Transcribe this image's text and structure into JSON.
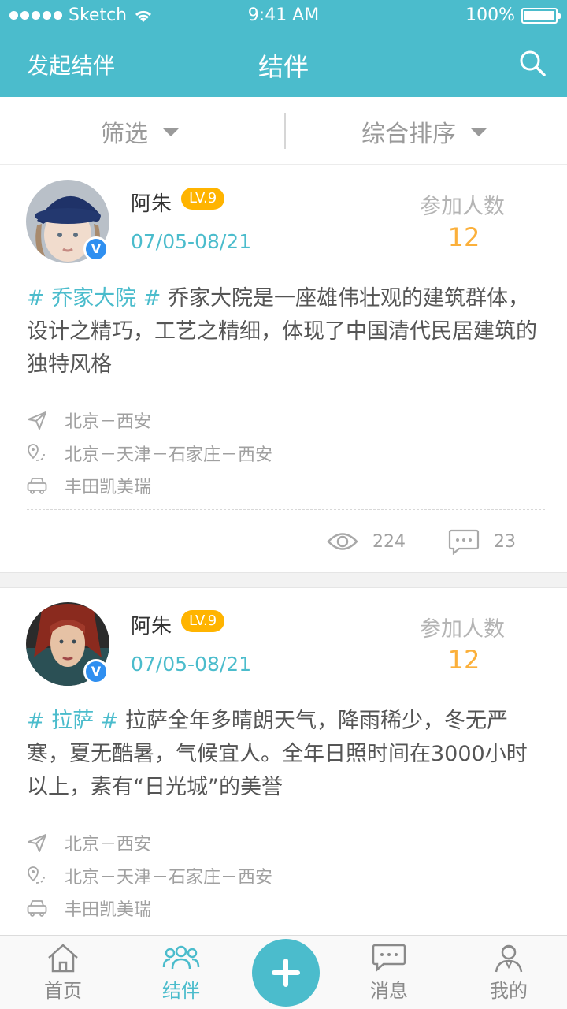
{
  "status_bar": {
    "carrier": "Sketch",
    "time": "9:41 AM",
    "battery": "100%"
  },
  "nav": {
    "left_action": "发起结伴",
    "title": "结伴",
    "search_icon": "search-icon"
  },
  "filters": [
    {
      "label": "筛选"
    },
    {
      "label": "综合排序"
    }
  ],
  "posts": [
    {
      "name": "阿朱",
      "level": "LV.9",
      "date_range": "07/05-08/21",
      "join_label": "参加人数",
      "join_count": "12",
      "tag": "# 乔家大院 #",
      "text": " 乔家大院是一座雄伟壮观的建筑群体，设计之精巧，工艺之精细，体现了中国清代民居建筑的独特风格",
      "route": "北京－西安",
      "waypoints": "北京－天津－石家庄－西安",
      "car": "丰田凯美瑞",
      "views": "224",
      "comments": "23"
    },
    {
      "name": "阿朱",
      "level": "LV.9",
      "date_range": "07/05-08/21",
      "join_label": "参加人数",
      "join_count": "12",
      "tag": "# 拉萨 #",
      "text": " 拉萨全年多晴朗天气，降雨稀少，冬无严寒，夏无酷暑，气候宜人。全年日照时间在3000小时以上，素有“日光城”的美誉",
      "route": "北京－西安",
      "waypoints": "北京－天津－石家庄－西安",
      "car": "丰田凯美瑞"
    }
  ],
  "tabbar": {
    "items": [
      {
        "label": "首页",
        "icon": "home-icon"
      },
      {
        "label": "结伴",
        "icon": "group-icon",
        "active": true
      },
      {
        "label": "",
        "icon": "plus-icon"
      },
      {
        "label": "消息",
        "icon": "message-icon"
      },
      {
        "label": "我的",
        "icon": "profile-icon"
      }
    ]
  },
  "colors": {
    "accent": "#4bbccc",
    "level": "#ffb400",
    "count": "#fbb03b",
    "verified": "#2f8ff0"
  }
}
